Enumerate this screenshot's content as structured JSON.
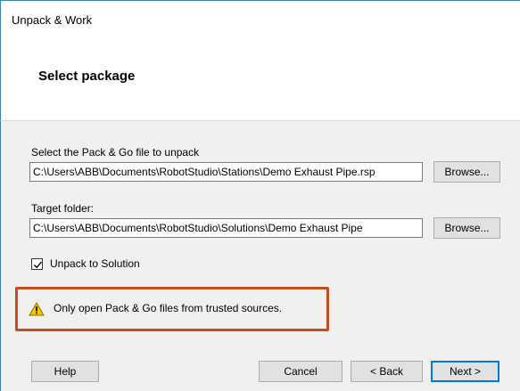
{
  "window": {
    "title": "Unpack & Work"
  },
  "header": {
    "heading": "Select package"
  },
  "form": {
    "file_label": "Select the Pack & Go file to unpack",
    "file_value": "C:\\Users\\ABB\\Documents\\RobotStudio\\Stations\\Demo Exhaust Pipe.rsp",
    "file_browse": "Browse...",
    "target_label": "Target folder:",
    "target_value": "C:\\Users\\ABB\\Documents\\RobotStudio\\Solutions\\Demo Exhaust Pipe",
    "target_browse": "Browse...",
    "unpack_to_solution_label": "Unpack to Solution",
    "unpack_to_solution_checked": true
  },
  "warning": {
    "icon": "warning-triangle-icon",
    "text": "Only open Pack & Go files from trusted sources.",
    "highlight_color": "#c0501d"
  },
  "footer": {
    "help": "Help",
    "cancel": "Cancel",
    "back": "< Back",
    "next": "Next >"
  },
  "colors": {
    "accent": "#0078d7",
    "content_bg": "#f0f0f0"
  }
}
